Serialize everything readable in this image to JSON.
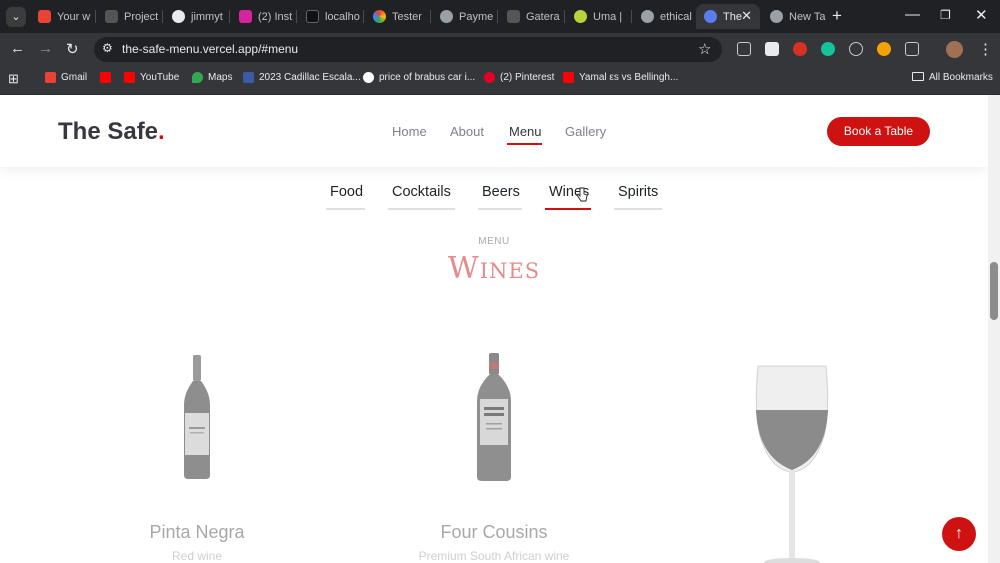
{
  "browser": {
    "tabs": [
      {
        "label": "Your w",
        "icon": "gmail-icon",
        "color": "#ea4335"
      },
      {
        "label": "Project",
        "icon": "upwork-icon",
        "color": "#2b2b2b"
      },
      {
        "label": "jimmyt",
        "icon": "github-icon",
        "color": "#e8eaed"
      },
      {
        "label": "(2) Inst",
        "icon": "instagram-icon",
        "color": "#d6249f"
      },
      {
        "label": "localho",
        "icon": "vercel-icon",
        "color": "#111111"
      },
      {
        "label": "Tester",
        "icon": "chrome-icon",
        "color": "#f4b400"
      },
      {
        "label": "Payme",
        "icon": "openai-icon",
        "color": "#9aa0a6"
      },
      {
        "label": "Gatera",
        "icon": "upwork-icon",
        "color": "#2b2b2b"
      },
      {
        "label": "Uma |",
        "icon": "sun-icon",
        "color": "#b7d33a"
      },
      {
        "label": "ethical",
        "icon": "globe-icon",
        "color": "#9aa0a6"
      },
      {
        "label": "The",
        "icon": "site-icon",
        "color": "#5b7cf0"
      },
      {
        "label": "New Ta",
        "icon": "chrome-icon",
        "color": "#9aa0a6"
      }
    ],
    "url": "the-safe-menu.vercel.app/#menu",
    "bookmarks": [
      {
        "label": "Gmail",
        "icon": "gmail-icon",
        "color": "#ea4335"
      },
      {
        "label": "",
        "icon": "youtube-icon",
        "color": "#ff0000"
      },
      {
        "label": "YouTube",
        "icon": "youtube-icon",
        "color": "#ff0000"
      },
      {
        "label": "Maps",
        "icon": "maps-icon",
        "color": "#34a853"
      },
      {
        "label": "2023 Cadillac Escala...",
        "icon": "usa-icon",
        "color": "#3b5ba5"
      },
      {
        "label": "price of brabus car i...",
        "icon": "google-icon",
        "color": "#ffffff"
      },
      {
        "label": "(2) Pinterest",
        "icon": "pinterest-icon",
        "color": "#e60023"
      },
      {
        "label": "Yamal εs vs Bellingh...",
        "icon": "youtube-icon",
        "color": "#ff0000"
      }
    ],
    "all_bookmarks": "All Bookmarks"
  },
  "site": {
    "brand": "The Safe",
    "brand_dot": ".",
    "nav": [
      "Home",
      "About",
      "Menu",
      "Gallery"
    ],
    "active_nav": "Menu",
    "cta": "Book a Table",
    "accent": "#ce1212"
  },
  "menu": {
    "categories": [
      "Food",
      "Cocktails",
      "Beers",
      "Wines",
      "Spirits"
    ],
    "active_category": "Wines",
    "label": "MENU",
    "title": "Wines",
    "items": [
      {
        "name": "Pinta Negra",
        "desc": "Red wine"
      },
      {
        "name": "Four Cousins",
        "desc": "Premium South African wine"
      },
      {
        "name": "",
        "desc": ""
      }
    ]
  }
}
